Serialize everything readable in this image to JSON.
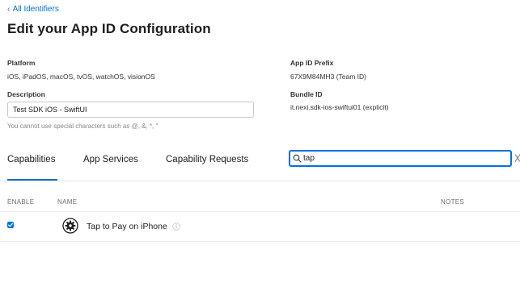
{
  "nav": {
    "back_chevron": "‹",
    "back_label": "All Identifiers"
  },
  "page": {
    "title": "Edit your App ID Configuration"
  },
  "platform": {
    "label": "Platform",
    "value": "iOS, iPadOS, macOS, tvOS, watchOS, visionOS"
  },
  "app_id_prefix": {
    "label": "App ID Prefix",
    "value": "67X9M84MH3 (Team ID)"
  },
  "description": {
    "label": "Description",
    "value": "Test SDK iOS - SwiftUI",
    "hint": "You cannot use special characters such as @, &, *, \""
  },
  "bundle_id": {
    "label": "Bundle ID",
    "value": "it.nexi.sdk-ios-swiftui01 (explicit)"
  },
  "tabs": [
    {
      "label": "Capabilities",
      "active": true
    },
    {
      "label": "App Services",
      "active": false
    },
    {
      "label": "Capability Requests",
      "active": false
    }
  ],
  "search": {
    "value": "tap",
    "icon": "search-icon"
  },
  "table": {
    "columns": {
      "enable": "ENABLE",
      "name": "NAME",
      "notes": "NOTES"
    },
    "rows": [
      {
        "enabled": true,
        "icon": "gear-badge-icon",
        "name": "Tap to Pay on iPhone",
        "notes": ""
      }
    ]
  },
  "colors": {
    "accent": "#0071e3",
    "link": "#0070c9",
    "hint_text": "#86868b",
    "divider": "#e5e5ea"
  }
}
